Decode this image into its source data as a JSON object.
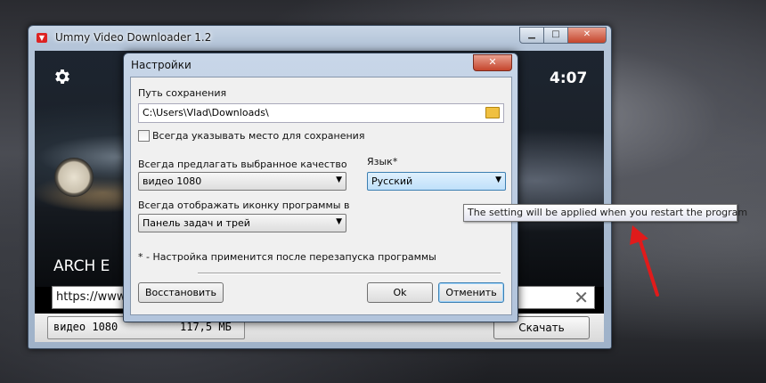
{
  "window": {
    "title": "Ummy Video Downloader 1.2",
    "controls": {
      "minimize": "▁",
      "maximize": "□",
      "close": "✕"
    }
  },
  "video": {
    "duration": "4:07",
    "title": "ARCH E",
    "url": "https://www.y"
  },
  "bottom_bar": {
    "quality_label": "видео 1080",
    "quality_size": "117,5 МБ",
    "download_label": "Скачать"
  },
  "settings_dialog": {
    "title": "Настройки",
    "close": "✕",
    "save_path_label": "Путь сохранения",
    "save_path_value": "C:\\Users\\Vlad\\Downloads\\",
    "always_ask_label": "Всегда указывать место для сохранения",
    "always_ask_checked": false,
    "quality_label": "Всегда предлагать выбранное качество",
    "quality_value": "видео 1080",
    "language_label": "Язык*",
    "language_value": "Русский",
    "icon_label": "Всегда отображать иконку программы в",
    "icon_value": "Панель задач и трей",
    "note": "* - Настройка применится после перезапуска программы",
    "restore_button": "Восстановить",
    "ok_button": "Ok",
    "cancel_button": "Отменить"
  },
  "tooltip": "The setting will be applied when you restart the program",
  "colors": {
    "arrow": "#e01b1b",
    "accent": "#3c7fb1",
    "close_red": "#c5452c"
  }
}
